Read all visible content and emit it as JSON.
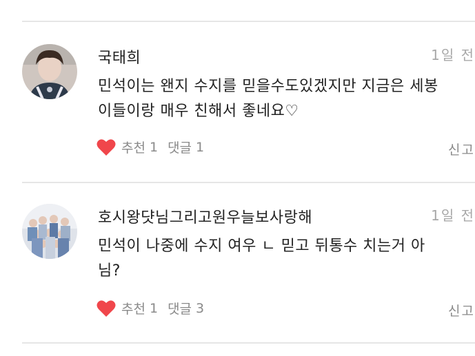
{
  "comments": [
    {
      "author": "국태희",
      "time": "1일 전",
      "text": "민석이는 왠지 수지를 믿을수도있겠지만 지금은 세봉이들이랑 매우 친해서 좋네요♡",
      "like_label": "추천",
      "like_count": "1",
      "reply_label": "댓글",
      "reply_count": "1",
      "report_label": "신고"
    },
    {
      "author": "호시왕댯님그리고원우늘보사랑해",
      "time": "1일 전",
      "text": "민석이 나중에 수지 여우 ㄴ 믿고 뒤통수 치는거 아님?",
      "like_label": "추천",
      "like_count": "1",
      "reply_label": "댓글",
      "reply_count": "3",
      "report_label": "신고"
    }
  ],
  "colors": {
    "heart": "#f0464b",
    "divider": "#e6e6e6",
    "meta_text": "#a8a8a8"
  },
  "icons": {
    "like": "heart-icon"
  }
}
